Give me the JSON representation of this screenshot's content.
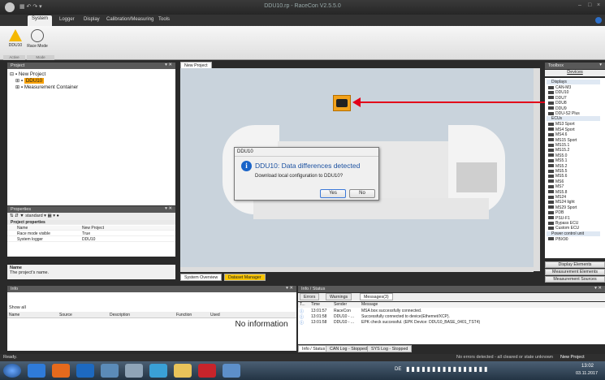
{
  "window": {
    "title": "DDU10.rp - RaceCon V2.5.5.0"
  },
  "menu": [
    "System",
    "Logger",
    "Display",
    "Calibration/Measuring",
    "Tools"
  ],
  "ribbon": {
    "buttons": [
      "DDU10",
      "Race Mode"
    ],
    "groups": [
      "Active",
      "Mode"
    ]
  },
  "project_panel": {
    "title": "Project",
    "root": "New Project",
    "child": "DDU10",
    "child2": "Measurement Container"
  },
  "properties_panel": {
    "title": "Properties",
    "toolbar_label": "standard",
    "section": "Project properties",
    "rows": [
      {
        "k": "Name",
        "v": "New Project"
      },
      {
        "k": "Race mode visible",
        "v": "True"
      },
      {
        "k": "System logger",
        "v": "DDU10"
      }
    ],
    "help_title": "Name",
    "help_text": "The project's name."
  },
  "canvas": {
    "tab": "New Project",
    "bottom_tabs": [
      "System Overview",
      "Dataset Manager"
    ]
  },
  "dialog": {
    "title": "DDU10",
    "heading": "DDU10: Data differences detected",
    "message": "Download local configuration to DDU10?",
    "yes": "Yes",
    "no": "No"
  },
  "toolbox": {
    "title": "Toolbox",
    "devices_tab": "Devices",
    "displays_label": "Displays",
    "displays": [
      "CAN-M3",
      "DDU10",
      "DDU7",
      "DDU8",
      "DDU9",
      "DDU-S2 Plus"
    ],
    "ecus_label": "ECUs",
    "ecus": [
      "MS3 Sport",
      "MS4 Sport",
      "MS4.6",
      "MS15 Sport",
      "MS15.1",
      "MS15.2",
      "MS5.0",
      "MS5.1",
      "MS5.2",
      "MS5.5",
      "MS5.6",
      "MS6",
      "MS7",
      "MS5.8",
      "MS24",
      "MS24 light",
      "MS29 Sport",
      "PDB",
      "PSU-F1",
      "Bypass ECU",
      "Custom ECU"
    ],
    "power_label": "Power control unit",
    "power_item": "PBX90",
    "buttons": [
      "Display Elements",
      "Measurement Elements",
      "Measurement Sources"
    ]
  },
  "info_panel": {
    "title": "Info",
    "show_all": "Show all",
    "columns": [
      "Name",
      "Source",
      "Description",
      "Function",
      "Used"
    ],
    "empty": "No information"
  },
  "status_panel": {
    "title": "Info / Status",
    "tabs": [
      "Errors",
      "Warnings",
      "Messages(3)"
    ],
    "columns": [
      "T...",
      "Time",
      "Sender",
      "Message"
    ],
    "rows": [
      {
        "time": "13:01:57",
        "sender": "RaceCon",
        "message": "MSA box successfully connected."
      },
      {
        "time": "13:01:58",
        "sender": "DDU10 - ...",
        "message": "Successfully connected to device(Ethernet/XCP)."
      },
      {
        "time": "13:01:58",
        "sender": "DDU10 - ...",
        "message": "EPK check successful. (EPK Device: DDU10_BASE_0401_TST4)"
      }
    ],
    "bottom_tabs": [
      "Info / Status",
      "CAN Log - Stopped",
      "SYS Log - Stopped"
    ]
  },
  "statusbar": {
    "left": "Ready.",
    "right": "No errors detected - all cleared or state unknown",
    "project": "New Project"
  },
  "taskbar": {
    "time": "13:02",
    "date": "03.11.2017",
    "lang": "DE"
  },
  "colors": {
    "accent": "#f7a000",
    "arrow": "#e2001a"
  }
}
